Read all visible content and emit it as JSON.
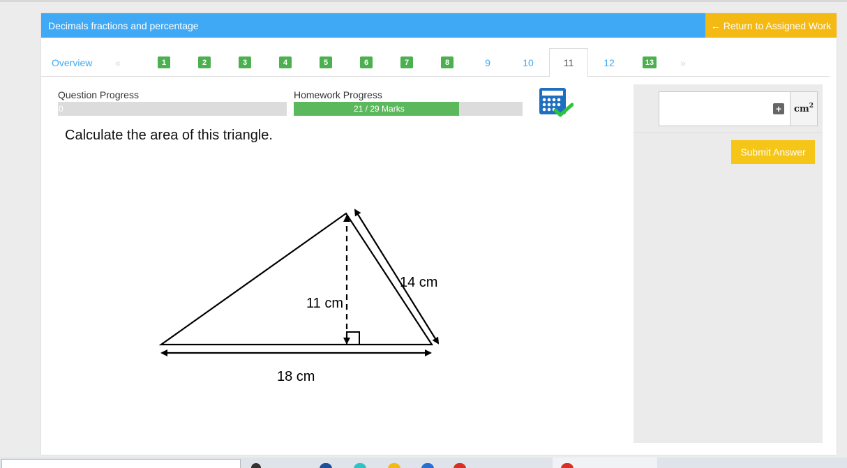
{
  "header": {
    "title": "Decimals fractions and percentage",
    "return_label": "Return to Assigned Work"
  },
  "tabs": {
    "overview": "Overview",
    "prev": "«",
    "next": "»",
    "items": [
      {
        "label": "1",
        "state": "complete"
      },
      {
        "label": "2",
        "state": "complete"
      },
      {
        "label": "3",
        "state": "complete"
      },
      {
        "label": "4",
        "state": "complete"
      },
      {
        "label": "5",
        "state": "complete"
      },
      {
        "label": "6",
        "state": "complete"
      },
      {
        "label": "7",
        "state": "complete"
      },
      {
        "label": "8",
        "state": "complete"
      },
      {
        "label": "9",
        "state": "open"
      },
      {
        "label": "10",
        "state": "open"
      },
      {
        "label": "11",
        "state": "active"
      },
      {
        "label": "12",
        "state": "open"
      },
      {
        "label": "13",
        "state": "complete"
      }
    ]
  },
  "progress": {
    "question_label": "Question Progress",
    "question_value": "0",
    "question_fraction": 0,
    "homework_label": "Homework Progress",
    "homework_text": "21 / 29 Marks",
    "homework_fraction": 0.724
  },
  "calculator_icon": "calculator-allowed-icon",
  "question": {
    "text": "Calculate the area of this triangle.",
    "labels": {
      "height": "11 cm",
      "side": "14 cm",
      "base": "18 cm"
    }
  },
  "answer": {
    "placeholder": "",
    "unit": "cm",
    "unit_power": "2",
    "submit_label": "Submit Answer"
  },
  "colors": {
    "header": "#3fa9f5",
    "return_button": "#f5b914",
    "complete_badge": "#4caf50",
    "submit_button": "#f5c518"
  }
}
